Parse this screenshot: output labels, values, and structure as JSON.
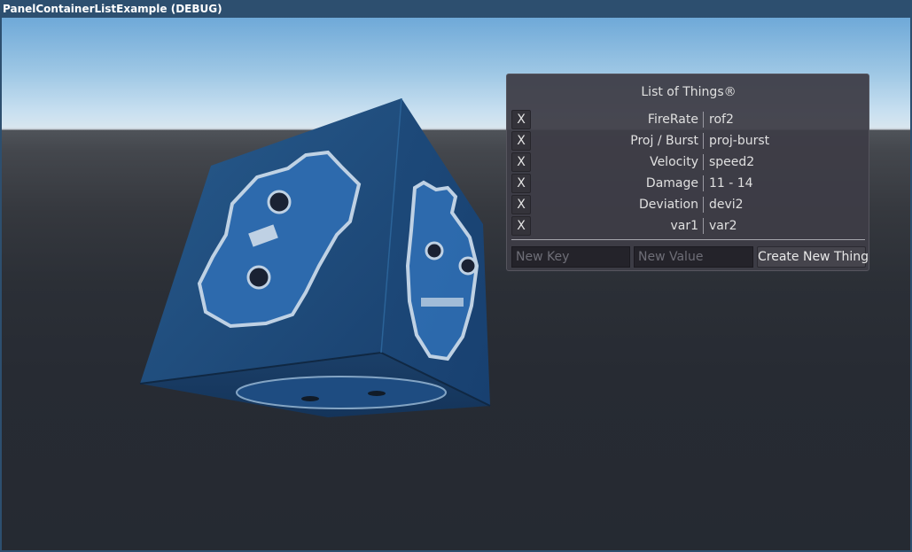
{
  "window": {
    "title": "PanelContainerListExample (DEBUG)"
  },
  "panel": {
    "title": "List of Things®",
    "rows": [
      {
        "delete_label": "X",
        "key": "FireRate",
        "value": "rof2"
      },
      {
        "delete_label": "X",
        "key": "Proj / Burst",
        "value": "proj-burst"
      },
      {
        "delete_label": "X",
        "key": "Velocity",
        "value": "speed2"
      },
      {
        "delete_label": "X",
        "key": "Damage",
        "value": "11 - 14"
      },
      {
        "delete_label": "X",
        "key": "Deviation",
        "value": "devi2"
      },
      {
        "delete_label": "X",
        "key": "var1",
        "value": "var2"
      }
    ],
    "new_key_placeholder": "New Key",
    "new_value_placeholder": "New Value",
    "create_button_label": "Create New Thing"
  },
  "scene": {
    "cube_icon": "godot-logo-icon",
    "cube_color": "#1f4a7a",
    "logo_color": "#2f6fb4"
  }
}
